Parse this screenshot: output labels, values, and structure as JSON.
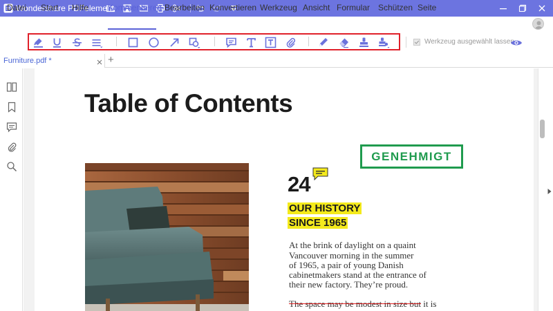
{
  "app": {
    "title": "Wondershare PDFelement",
    "title_bar_color": "#6c74e0",
    "accent_color": "#5a62d8",
    "quick_icons": [
      "open-folder-icon",
      "save-icon",
      "email-icon",
      "print-icon",
      "scissors-icon",
      "undo-icon",
      "redo-icon",
      "customize-toolbar-icon"
    ],
    "window_controls": [
      "minimize-icon",
      "maximize-icon",
      "close-icon"
    ]
  },
  "menu": {
    "items": [
      "Datei",
      "Start",
      "Hilfe",
      "Kommentieren",
      "Bearbeiten",
      "Konvertieren",
      "Werkzeug",
      "Ansicht",
      "Formular",
      "Schützen",
      "Seite"
    ],
    "active_index": 3
  },
  "ribbon": {
    "tools": [
      "highlight-icon",
      "underline-icon",
      "strikethrough-icon",
      "text-lines-icon",
      "rectangle-icon",
      "oval-icon",
      "arrow-icon",
      "shape-dropdown-icon",
      "sticky-note-icon",
      "typewriter-icon",
      "textbox-icon",
      "attachment-icon",
      "pencil-icon",
      "eraser-icon",
      "stamp-icon",
      "signature-stamp-icon"
    ],
    "keep_tool_label": "Werkzeug ausgewählt lassen",
    "keep_tool_checked": true,
    "highlight_frame_color": "#e0202a"
  },
  "tabs": {
    "items": [
      {
        "label": "Furniture.pdf *"
      }
    ],
    "add_label": "+"
  },
  "sidebar": {
    "icons": [
      "page-thumbnails-icon",
      "bookmark-icon",
      "comments-icon",
      "attachments-icon",
      "search-icon"
    ]
  },
  "document": {
    "title": "Table of Contents",
    "stamp_text": "GENEHMIGT",
    "stamp_color": "#1f9b4e",
    "page_number": "24",
    "highlight_color": "#f4ea1c",
    "highlight_lines": [
      "OUR HISTORY",
      "SINCE 1965"
    ],
    "body_lines": [
      "At the brink of daylight on a quaint",
      "Vancouver morning in the summer",
      "of 1965, a pair of young Danish",
      "cabinetmakers stand at the entrance of",
      "their new factory. They’re proud."
    ],
    "strike_text": "The space may be modest in size but",
    "strike_rest": " it is"
  }
}
